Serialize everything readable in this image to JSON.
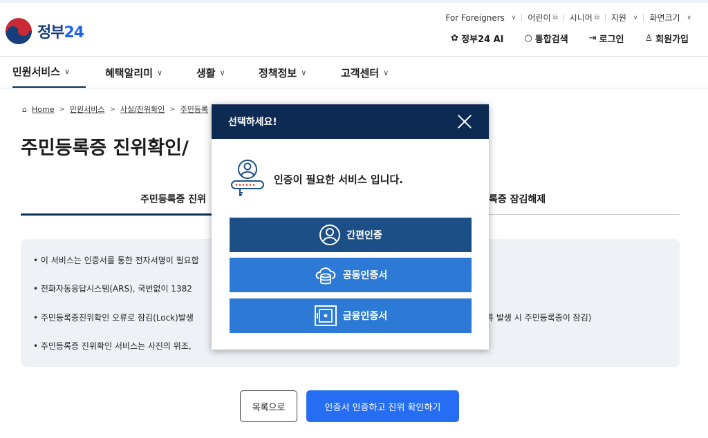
{
  "header": {
    "logo_text": "정부",
    "logo_num": "24",
    "util": {
      "foreigners": "For Foreigners",
      "kids": "어린이",
      "senior": "시니어",
      "support": "지원",
      "font_size": "화면크기"
    },
    "actions": {
      "ai": "정부24 AI",
      "search": "통합검색",
      "login": "로그인",
      "signup": "회원가입"
    }
  },
  "nav": {
    "items": [
      "민원서비스",
      "혜택알리미",
      "생활",
      "정책정보",
      "고객센터"
    ]
  },
  "breadcrumb": {
    "home": "Home",
    "items": [
      "민원서비스",
      "사실/진위확인",
      "주민등록"
    ]
  },
  "page": {
    "title": "주민등록증 진위확인/",
    "tab_left": "주민등록증 진위",
    "tab_right": "록증 잠김해제"
  },
  "info": {
    "line1": "• 이 서비스는 인증서를 통한 전자서명이 필요합",
    "line2": "• 전화자동응답시스템(ARS), 국번없이 1382",
    "line3a": "• 주민등록증진위확인 오류로 잠김(Lock)발생",
    "line3b": "류 발생 시 주민등록증이 잠김)",
    "line4": "• 주민등록증 진위확인 서비스는 사진의 위조,"
  },
  "buttons": {
    "list": "목록으로",
    "confirm": "인증서 인증하고 진위 확인하기"
  },
  "modal": {
    "title": "선택하세요!",
    "message": "인증이 필요한 서비스 입니다.",
    "simple_auth": "간편인증",
    "joint_cert": "공동인증서",
    "finance_cert": "금융인증서"
  },
  "colors": {
    "navy": "#0d2a52",
    "simple_btn": "#1d4f87",
    "cert_btn": "#2d7ad6",
    "primary": "#256ef4"
  }
}
